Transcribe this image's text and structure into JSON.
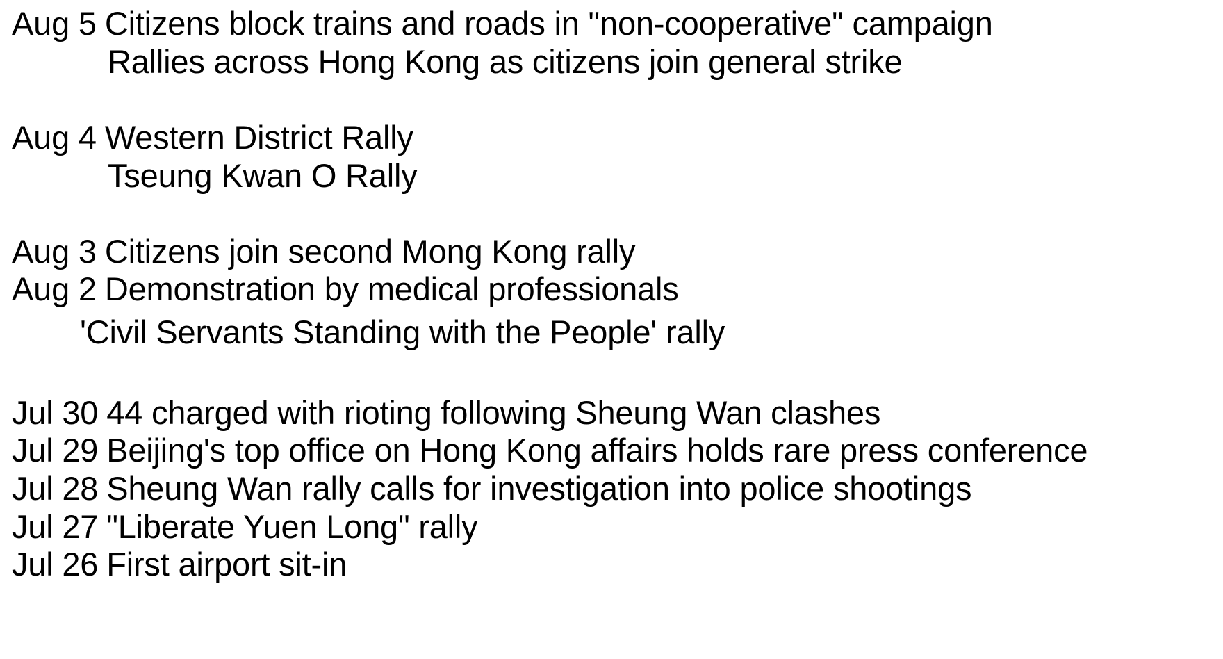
{
  "timeline": [
    {
      "date": "Aug 5",
      "events": [
        "Citizens block trains and roads in \"non-cooperative\" campaign",
        "Rallies across Hong Kong as citizens join general strike"
      ]
    },
    {
      "date": "Aug 4",
      "events": [
        "Western District Rally",
        "Tseung Kwan O Rally"
      ]
    },
    {
      "date": "Aug 3",
      "events": [
        "Citizens join second Mong Kong rally"
      ]
    },
    {
      "date": "Aug 2",
      "events": [
        "Demonstration by medical professionals",
        "'Civil Servants Standing with the People' rally"
      ]
    },
    {
      "date": "Jul 30",
      "events": [
        "44 charged with rioting following Sheung Wan clashes"
      ]
    },
    {
      "date": "Jul 29",
      "events": [
        "Beijing's top office on Hong Kong affairs holds rare press conference"
      ]
    },
    {
      "date": "Jul 28",
      "events": [
        "Sheung Wan rally calls for investigation into police shootings"
      ]
    },
    {
      "date": "Jul 27",
      "events": [
        "\"Liberate Yuen Long\" rally"
      ]
    },
    {
      "date": "Jul 26",
      "events": [
        "First airport sit-in"
      ]
    }
  ]
}
